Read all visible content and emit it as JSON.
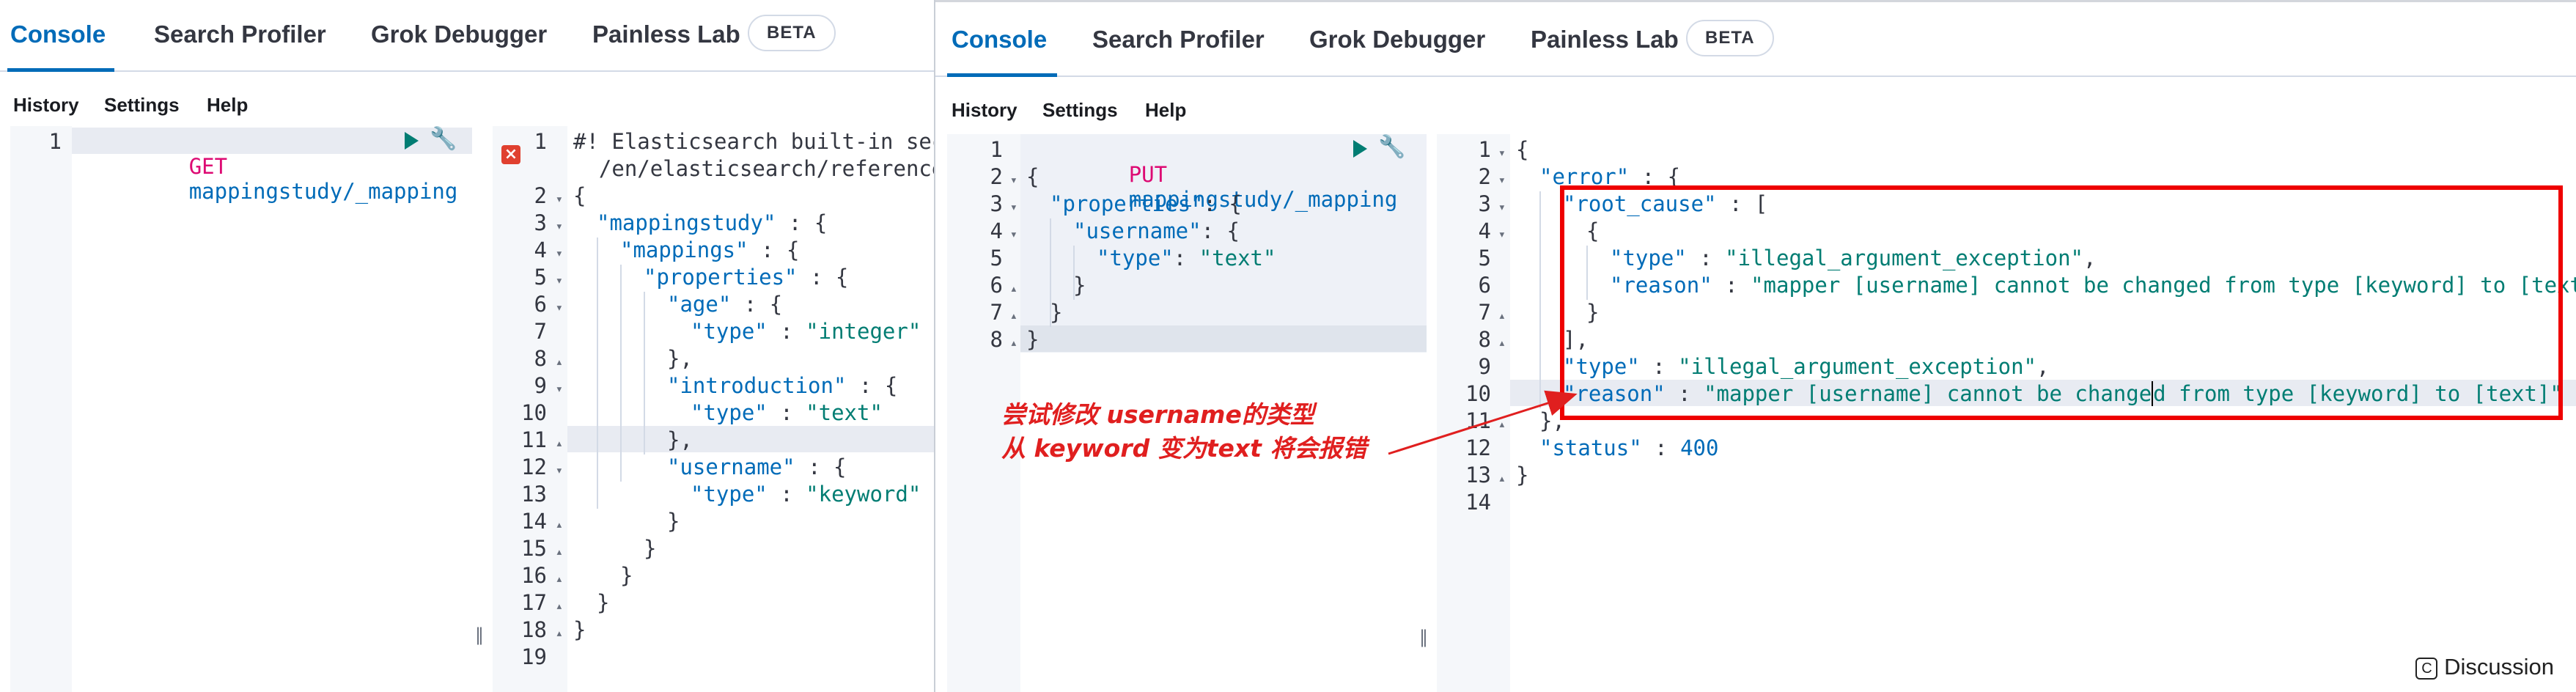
{
  "tabs": {
    "console": "Console",
    "search_profiler": "Search Profiler",
    "grok_debugger": "Grok Debugger",
    "painless_lab": "Painless Lab",
    "beta": "BETA"
  },
  "menu": {
    "history": "History",
    "settings": "Settings",
    "help": "Help"
  },
  "left_request": {
    "line_numbers": [
      "1"
    ],
    "method": "GET",
    "path": "mappingstudy/_mapping"
  },
  "left_response": {
    "line_numbers": [
      "1",
      "",
      "2",
      "3",
      "4",
      "5",
      "6",
      "7",
      "8",
      "9",
      "10",
      "11",
      "12",
      "13",
      "14",
      "15",
      "16",
      "17",
      "18",
      "19"
    ],
    "comment_1": "#! Elasticsearch built-in secu",
    "comment_2": "  /en/elasticsearch/reference/",
    "t_open": "{",
    "t_mappingstudy": "\"mappingstudy\"",
    "t_mappings": "\"mappings\"",
    "t_properties": "\"properties\"",
    "t_age": "\"age\"",
    "t_type": "\"type\"",
    "t_integer": "\"integer\"",
    "t_introduction": "\"introduction\"",
    "t_text": "\"text\"",
    "t_username": "\"username\"",
    "t_keyword": "\"keyword\"",
    "t_close": "}",
    "t_close_comma": "},",
    "colon_brace": " : {",
    "colon": " : "
  },
  "right_request": {
    "line_numbers": [
      "1",
      "2",
      "3",
      "4",
      "5",
      "6",
      "7",
      "8"
    ],
    "method": "PUT",
    "path": "mappingstudy/_mapping",
    "t_properties": "\"properties\"",
    "t_username": "\"username\"",
    "t_type": "\"type\"",
    "t_text": "\"text\"",
    "colon_brace": ": {",
    "colon": ": "
  },
  "right_response": {
    "line_numbers": [
      "1",
      "2",
      "3",
      "4",
      "5",
      "6",
      "7",
      "8",
      "9",
      "10",
      "11",
      "12",
      "13",
      "14"
    ],
    "t_error": "\"error\"",
    "t_root_cause": "\"root_cause\"",
    "t_type": "\"type\"",
    "t_reason": "\"reason\"",
    "t_status": "\"status\"",
    "v_exception": "\"illegal_argument_exception\"",
    "v_reason": "\"mapper [username] cannot be changed from type [keyword] to [text]\"",
    "v_reason_cursor_a": "\"mapper [username] cannot be change",
    "v_reason_cursor_b": "d from type [keyword] to [text]\"",
    "v_status": "400",
    "open": "{",
    "close": "}",
    "close_comma": "},",
    "bracket_open": " : [",
    "bracket_close": "],",
    "colon_brace": " : {",
    "colon": " : ",
    "comma": ","
  },
  "annotation": {
    "line1_a": "尝试修改 ",
    "line1_b": "username",
    "line1_c": "的类型",
    "line2_a": "从 ",
    "line2_b": "keyword",
    "line2_c": " 变为",
    "line2_d": "text",
    "line2_e": "  将会报错"
  },
  "watermark": {
    "icon": "C",
    "text": "Discussion"
  },
  "colors": {
    "accent": "#006bb8",
    "annotation_red": "#e01f1f",
    "string": "#017d73",
    "method": "#dd0a73"
  }
}
